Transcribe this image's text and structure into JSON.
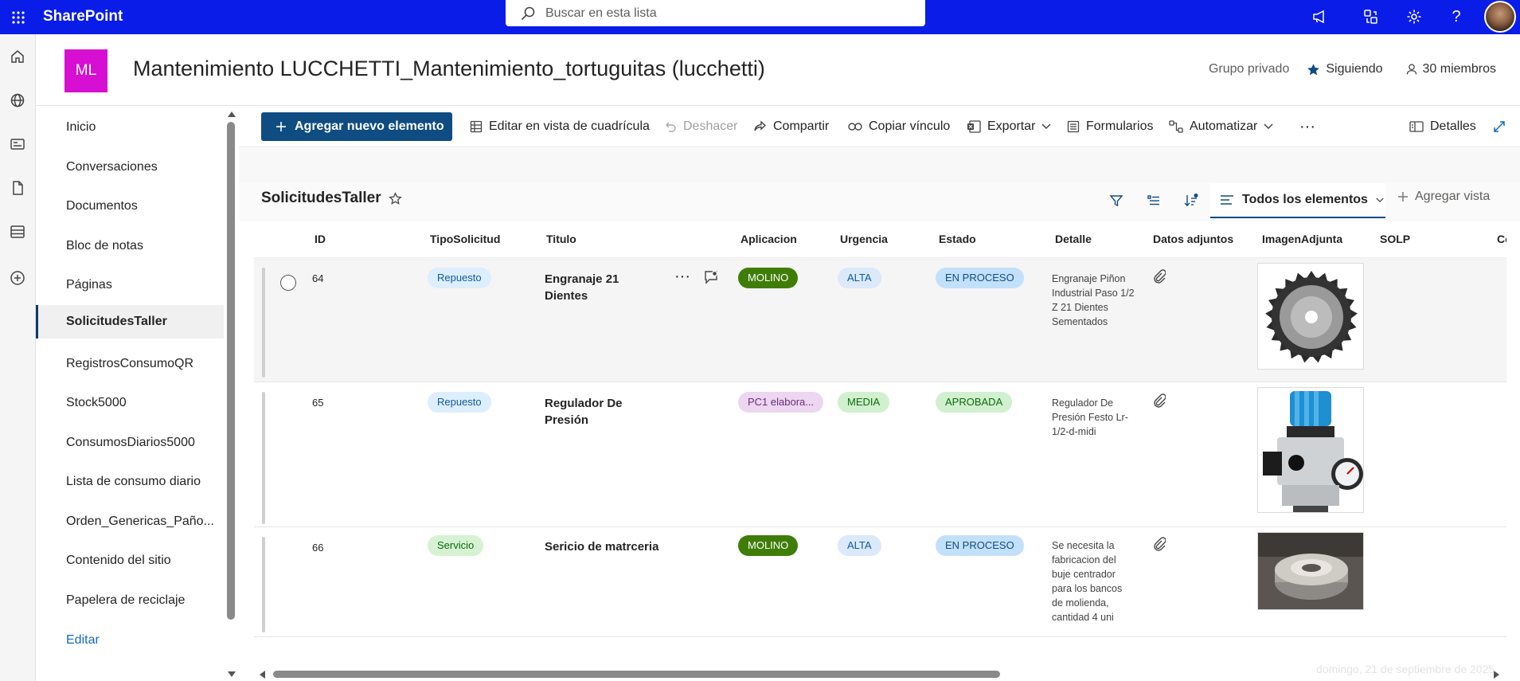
{
  "suitebar": {
    "brand": "SharePoint",
    "search_placeholder": "Buscar en esta lista",
    "icons": [
      "app-launcher-icon",
      "megaphone-icon",
      "share-network-icon",
      "gear-icon",
      "help-icon"
    ]
  },
  "site": {
    "logo": "ML",
    "title": "Mantenimiento LUCCHETTI_Mantenimiento_tortuguitas (lucchetti)",
    "privacy": "Grupo privado",
    "follow": "Siguiendo",
    "members": "30 miembros"
  },
  "nav": {
    "items": [
      "Inicio",
      "Conversaciones",
      "Documentos",
      "Bloc de notas",
      "Páginas",
      "SolicitudesTaller",
      "RegistrosConsumoQR",
      "Stock5000",
      "ConsumosDiarios5000",
      "Lista de consumo diario",
      "Orden_Genericas_Paño...",
      "Contenido del sitio",
      "Papelera de reciclaje"
    ],
    "selected": "SolicitudesTaller",
    "edit": "Editar"
  },
  "commands": {
    "new": "Agregar nuevo elemento",
    "grid": "Editar en vista de cuadrícula",
    "undo": "Deshacer",
    "share": "Compartir",
    "copylink": "Copiar vínculo",
    "export": "Exportar",
    "forms": "Formularios",
    "automate": "Automatizar",
    "details": "Detalles"
  },
  "list": {
    "title": "SolicitudesTaller",
    "view": "Todos los elementos",
    "add_view": "Agregar vista",
    "columns": [
      "ID",
      "TipoSolicitud",
      "Titulo",
      "Aplicacion",
      "Urgencia",
      "Estado",
      "Detalle",
      "Datos adjuntos",
      "ImagenAdjunta",
      "SOLP",
      "Co"
    ],
    "rows": [
      {
        "id": "64",
        "tipo": "Repuesto",
        "titulo": "Engranaje 21 Dientes",
        "aplicacion": "MOLINO",
        "urgencia": "ALTA",
        "estado": "EN PROCESO",
        "detalle": "Engranaje Piñon Industrial Paso 1/2 Z 21 Dientes Sementados",
        "imagen": "sprocket-image"
      },
      {
        "id": "65",
        "tipo": "Repuesto",
        "titulo": "Regulador De Presión",
        "aplicacion": "PC1 elabora...",
        "urgencia": "MEDIA",
        "estado": "APROBADA",
        "detalle": "Regulador De Presión Festo Lr-1/2-d-midi",
        "imagen": "pressure-regulator-image"
      },
      {
        "id": "66",
        "tipo": "Servicio",
        "titulo": "Sericio de matrceria",
        "aplicacion": "MOLINO",
        "urgencia": "ALTA",
        "estado": "EN PROCESO",
        "detalle": "Se necesita la fabricacion del buje centrador para los bancos de molienda, cantidad 4 uni",
        "imagen": "metal-bushing-image"
      }
    ]
  },
  "watermark": "domingo, 21 de septiembre de 2025",
  "colors": {
    "suitebar": "#0a1de8",
    "logo": "#d70fd2",
    "primary_button": "#0f4c81",
    "molino": "#3f7d08",
    "alta": "#dbe9fa",
    "proceso": "#c3e0fb",
    "aprobada": "#d1f0cf",
    "pc1": "#ecd6f0",
    "repuesto": "#ddeefe",
    "servicio": "#d6f2d3"
  }
}
